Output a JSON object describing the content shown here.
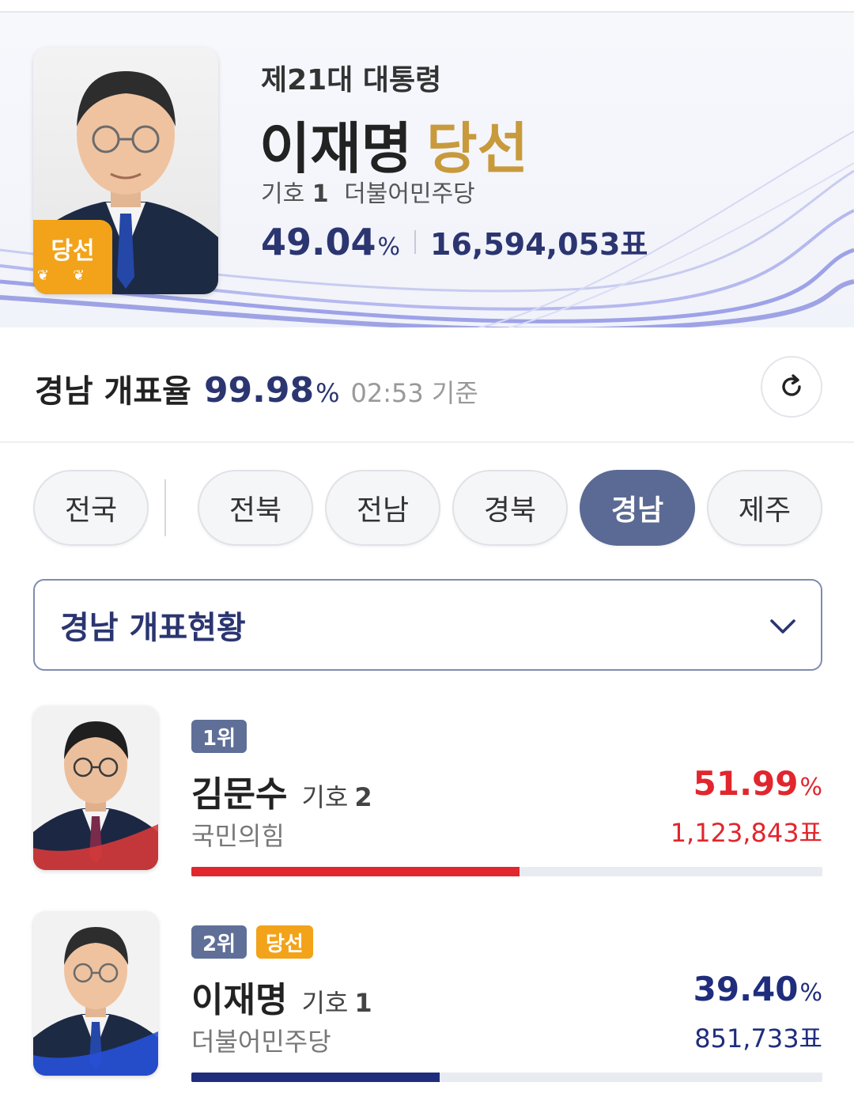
{
  "hero": {
    "subtitle": "제21대 대통령",
    "name": "이재명",
    "elected_label": "당선",
    "badge_label": "당선",
    "number_label": "기호",
    "number": "1",
    "party": "더불어민주당",
    "pct": "49.04",
    "pct_sign": "%",
    "votes": "16,594,053표"
  },
  "count_rate": {
    "label": "경남 개표율",
    "pct": "99.98",
    "pct_sign": "%",
    "time": "02:53 기준"
  },
  "regions": {
    "items": [
      {
        "label": "전국",
        "active": false
      },
      {
        "label": "전북",
        "active": false
      },
      {
        "label": "전남",
        "active": false
      },
      {
        "label": "경북",
        "active": false
      },
      {
        "label": "경남",
        "active": true
      },
      {
        "label": "제주",
        "active": false
      }
    ]
  },
  "dropdown": {
    "label": "경남 개표현황"
  },
  "candidates": [
    {
      "rank": "1위",
      "elected": false,
      "name": "김문수",
      "number_label": "기호",
      "number": "2",
      "party": "국민의힘",
      "pct": "51.99",
      "pct_sign": "%",
      "votes": "1,123,843표",
      "share": 51.99,
      "color": "#e1262d",
      "accent": "#d63a3a"
    },
    {
      "rank": "2위",
      "elected": true,
      "elected_label": "당선",
      "name": "이재명",
      "number_label": "기호",
      "number": "1",
      "party": "더불어민주당",
      "pct": "39.40",
      "pct_sign": "%",
      "votes": "851,733표",
      "share": 39.4,
      "color": "#1f2d7c",
      "accent": "#2750d8"
    }
  ],
  "colors": {
    "navy": "#2b3570",
    "gold": "#c89a3c",
    "badge_orange": "#f2a31a",
    "chip_active": "#5b6a94",
    "red": "#e1262d"
  },
  "icons": {
    "refresh": "refresh-icon",
    "chevron": "chevron-down-icon",
    "laurel": "laurel-icon"
  }
}
